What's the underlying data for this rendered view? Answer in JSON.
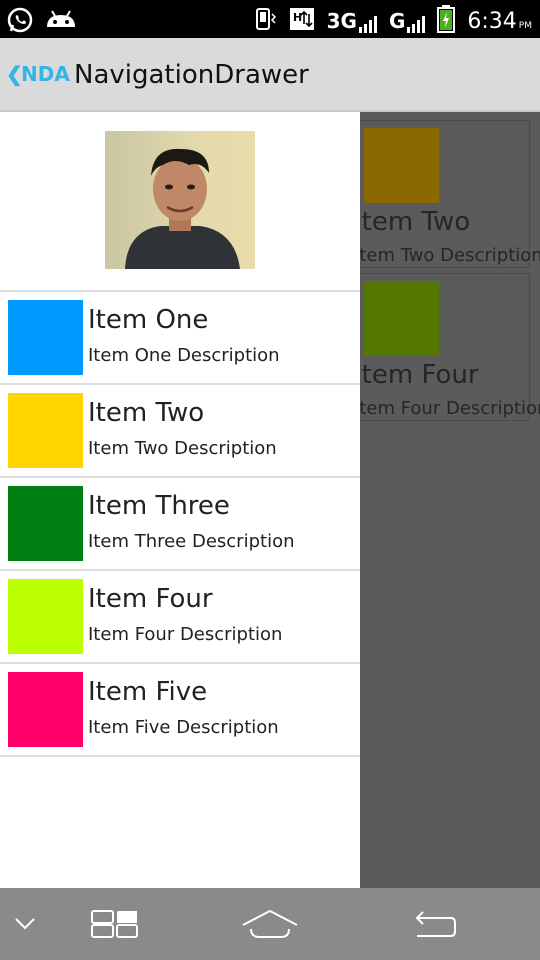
{
  "status_bar": {
    "network_1": "3G",
    "network_2": "G",
    "time": "6:34",
    "ampm": "PM"
  },
  "action_bar": {
    "logo": "NDA",
    "title": "NavigationDrawer"
  },
  "background_cards": [
    {
      "title": "Item Two",
      "description": "Item Two Description",
      "color": "#8a6a00"
    },
    {
      "title": "Item Four",
      "description": "Item Four Description",
      "color": "#557800"
    }
  ],
  "drawer": {
    "items": [
      {
        "title": "Item One",
        "description": "Item One Description",
        "color": "#0099ff"
      },
      {
        "title": "Item Two",
        "description": "Item Two Description",
        "color": "#ffd600"
      },
      {
        "title": "Item Three",
        "description": "Item Three Description",
        "color": "#008013"
      },
      {
        "title": "Item Four",
        "description": "Item Four Description",
        "color": "#bbff00"
      },
      {
        "title": "Item Five",
        "description": "Item Five Description",
        "color": "#ff006a"
      }
    ]
  },
  "icons": {
    "status_left": [
      "whatsapp-icon",
      "android-icon"
    ],
    "status_right": [
      "vibrate-icon",
      "data-transfer-icon",
      "signal-icon",
      "battery-charging-icon"
    ],
    "nav": [
      "chevron-down-icon",
      "recent-apps-icon",
      "home-icon",
      "back-icon"
    ]
  }
}
